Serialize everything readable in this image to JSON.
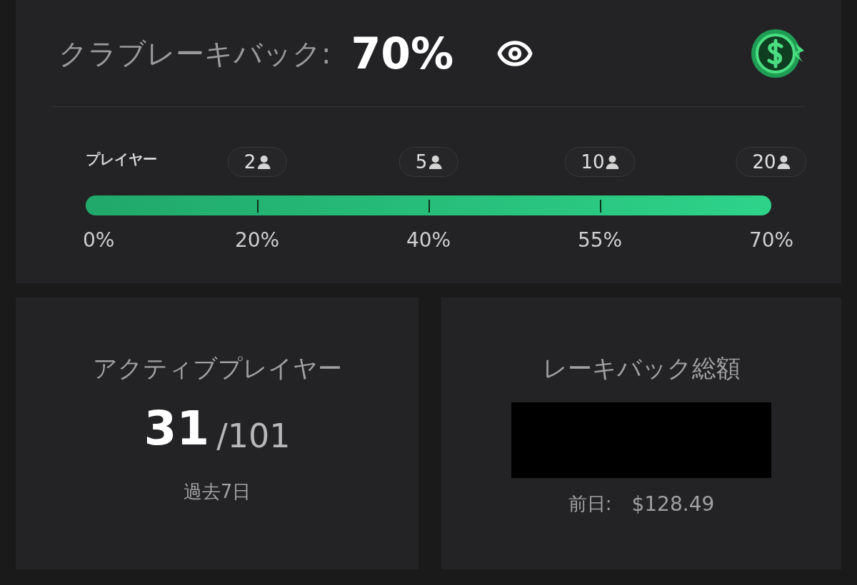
{
  "header": {
    "label": "クラブレーキバック:",
    "value": "70%"
  },
  "progress": {
    "label": "プレイヤー",
    "level": 1,
    "start_percent": "0%",
    "milestones": [
      {
        "players": "2",
        "percent": "20%"
      },
      {
        "players": "5",
        "percent": "40%"
      },
      {
        "players": "10",
        "percent": "55%"
      },
      {
        "players": "20",
        "percent": "70%"
      }
    ]
  },
  "active_players": {
    "title": "アクティブプレイヤー",
    "count": "31",
    "total": "/101",
    "period": "過去7日"
  },
  "rakeback_total": {
    "title": "レーキバック総額",
    "redacted": true,
    "previous_label": "前日:",
    "previous_value": "$128.49"
  }
}
